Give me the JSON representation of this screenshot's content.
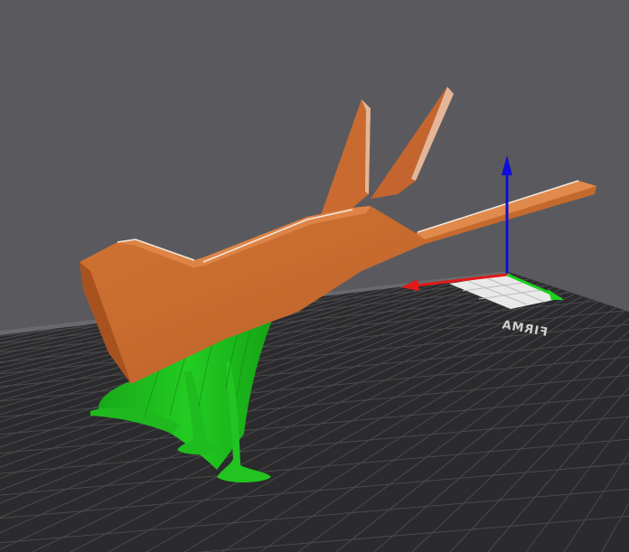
{
  "viewport": {
    "background_color": "#5a5a5e",
    "bed_color": "#2b2b2d",
    "bed_grid_color": "#4a4a4c",
    "model_color": "#c8692f",
    "support_color": "#1ec01e"
  },
  "bed": {
    "label": "FIRMA"
  },
  "axes": {
    "x_color": "#e01a1a",
    "y_color": "#1ed11e",
    "z_color": "#0e0ed8"
  }
}
